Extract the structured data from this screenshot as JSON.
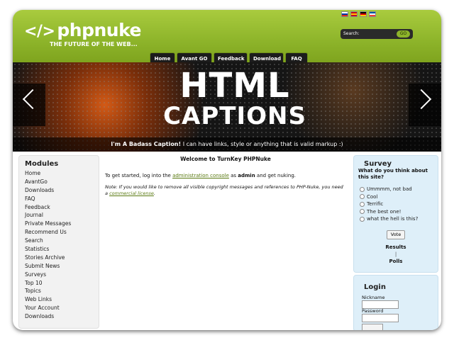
{
  "header": {
    "logo_bracket": "</>",
    "logo_text": "phpnuke",
    "tagline": "THE FUTURE OF THE WEB...",
    "flags": [
      {
        "name": "russian-flag-icon",
        "color_top": "#ffffff",
        "color_mid": "#0039a6",
        "color_bottom": "#d52b1e"
      },
      {
        "name": "spanish-flag-icon",
        "color_top": "#c60b1e",
        "color_mid": "#ffc400",
        "color_bottom": "#c60b1e"
      },
      {
        "name": "german-flag-icon",
        "color_top": "#000000",
        "color_mid": "#dd0000",
        "color_bottom": "#ffce00"
      },
      {
        "name": "french-flag-icon",
        "color_top": "#0055a4",
        "color_mid": "#ffffff",
        "color_bottom": "#ef4135"
      }
    ],
    "search_label": "Search:",
    "search_button": "GO",
    "nav": [
      "Home",
      "Avant GO",
      "Feedback",
      "Download",
      "FAQ"
    ]
  },
  "banner": {
    "title_line1": "HTML",
    "title_line2": "CAPTIONS",
    "caption_bold": "I'm A Badass Caption!",
    "caption_rest": " I can have links, style or anything that is valid markup :)"
  },
  "modules": {
    "title": "Modules",
    "items": [
      "Home",
      "AvantGo",
      "Downloads",
      "FAQ",
      "Feedback",
      "Journal",
      "Private Messages",
      "Recommend Us",
      "Search",
      "Statistics",
      "Stories Archive",
      "Submit News",
      "Surveys",
      "Top 10",
      "Topics",
      "Web Links",
      "Your Account",
      "Downloads"
    ]
  },
  "main": {
    "welcome": "Welcome to TurnKey PHPNuke",
    "intro_pre": "To get started, log into the ",
    "intro_link": "administration console",
    "intro_mid": " as ",
    "intro_user": "admin",
    "intro_post": " and get nuking.",
    "note_pre": "Note: If you would like to remove all visible copyright messages and references to PHP-Nuke, you need a ",
    "note_link": "commercial license",
    "note_post": "."
  },
  "survey": {
    "title": "Survey",
    "question": "What do you think about this site?",
    "options": [
      "Ummmm, not bad",
      "Cool",
      "Terrific",
      "The best one!",
      "what the hell is this?"
    ],
    "vote": "Vote",
    "results": "Results",
    "separator": "|",
    "polls": "Polls"
  },
  "login": {
    "title": "Login",
    "nickname": "Nickname",
    "password": "Password"
  }
}
